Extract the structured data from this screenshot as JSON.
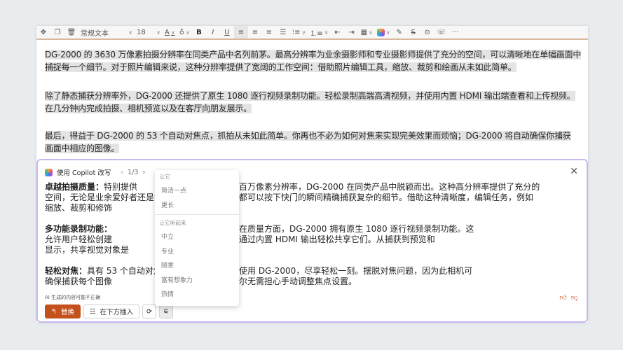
{
  "toolbar": {
    "style": "常规文本",
    "font_size": "18",
    "bold": "B",
    "italic": "I",
    "underline": "U",
    "more": "···"
  },
  "document": {
    "paragraphs": [
      [
        "DG-2000 的 3630 万像素拍摄分辨率在同类产品中名列前茅。最高分辨率为业余摄影师和专业摄影师提供了充分的空间，可以清晰地在单幅画面中",
        "捕捉每一个细节。对于照片编辑来说，这种分辨率提供了宽阔的工作空间：借助照片编辑工具，缩放、裁剪和绘画从未如此简单。"
      ],
      [
        "除了静态捕获分辨率外，DG-2000 还提供了原生 1080 逐行视频录制功能。轻松录制高端高清视频，并使用内置 HDMI 输出端查看和上传视频。",
        "在几分钟内完成拍摄、相机预览以及在客厅向朋友展示。"
      ],
      [
        "最后，得益于 DG-2000 的 53 个自动对焦点，抓拍从未如此简单。你再也不必为如何对焦来实现完美效果而烦恼；DG-2000 将自动确保你捕获",
        "画面中相应的图像。"
      ]
    ]
  },
  "copilot": {
    "title": "使用 Copilot 改写",
    "pager": "1/3",
    "sections": [
      {
        "heading": "卓越拍摄质量：",
        "lines_left": [
          "特别提供",
          "空间，无论是业余爱好者还是专",
          "缩放、裁剪和修饰"
        ],
        "lines_right": [
          "百万像素分辨率，DG-2000 在同类产品中脱颖而出。这种高分辨率提供了充分的",
          "都可以按下快门的瞬间精确捕获复杂的细节。借助这种清晰度，编辑任务，例如",
          ""
        ]
      },
      {
        "heading": "多功能录制功能：",
        "lines_left": [
          "",
          "允许用户轻松创建",
          "显示，共享视觉对象是"
        ],
        "lines_right": [
          "在质量方面，DG-2000 拥有原生 1080 逐行视频录制功能。这",
          "通过内置 HDMI 输出轻松共享它们。从捕获到预览和",
          ""
        ]
      },
      {
        "heading": "轻松对焦：",
        "lines_left": [
          "具有 53 个自动对焦",
          "确保捕获每个图像"
        ],
        "lines_right": [
          "使用 DG-2000，尽享轻松一刻。摆脱对焦问题，因为此相机可",
          "尔无需担心手动调整焦点设置。"
        ]
      }
    ],
    "disclaimer": "AI 生成的内容可能不正确",
    "replace": "替换",
    "insert_below": "在下方插入"
  },
  "menu": {
    "group1": "让它",
    "items1": [
      "简洁一点",
      "更长"
    ],
    "group2": "让它听起来",
    "items2": [
      "中立",
      "专业",
      "随意",
      "富有想象力",
      "热情"
    ]
  },
  "colors": {
    "accent": "#c4501b",
    "copilot_border": "#c9b8f0"
  }
}
